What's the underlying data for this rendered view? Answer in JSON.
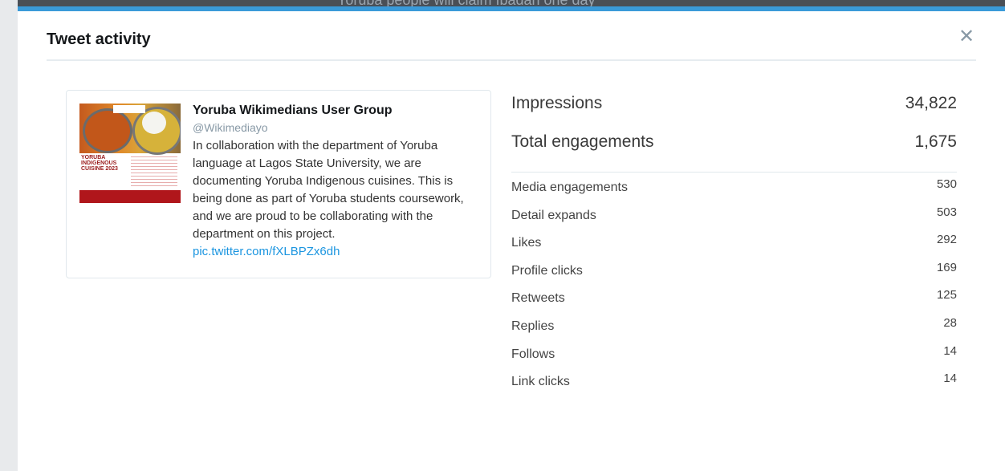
{
  "background": {
    "top_text": "Yoruba people will claim Ibadan one day"
  },
  "modal": {
    "title": "Tweet activity",
    "close_symbol": "✕"
  },
  "tweet": {
    "author": "Yoruba Wikimedians User Group",
    "handle": "@Wikimediayo",
    "text": "In collaboration with the department of Yoruba language at Lagos State University, we are documenting Yoruba Indigenous cuisines. This is being done as part of Yoruba students coursework, and we are proud to be collaborating with the department on this project.",
    "link": "pic.twitter.com/fXLBPZx6dh",
    "thumbnail_title": "YORUBA INDIGENOUS CUISINE 2023"
  },
  "stats": {
    "impressions": {
      "label": "Impressions",
      "value": "34,822"
    },
    "total_engagements": {
      "label": "Total engagements",
      "value": "1,675"
    },
    "breakdown": [
      {
        "label": "Media engagements",
        "value": "530"
      },
      {
        "label": "Detail expands",
        "value": "503"
      },
      {
        "label": "Likes",
        "value": "292"
      },
      {
        "label": "Profile clicks",
        "value": "169"
      },
      {
        "label": "Retweets",
        "value": "125"
      },
      {
        "label": "Replies",
        "value": "28"
      },
      {
        "label": "Follows",
        "value": "14"
      },
      {
        "label": "Link clicks",
        "value": "14"
      }
    ]
  },
  "colors": {
    "accent": "#3a9ad9",
    "link": "#1b95e0",
    "brand_red": "#b0161b"
  },
  "icons": {
    "close": "close-icon"
  }
}
